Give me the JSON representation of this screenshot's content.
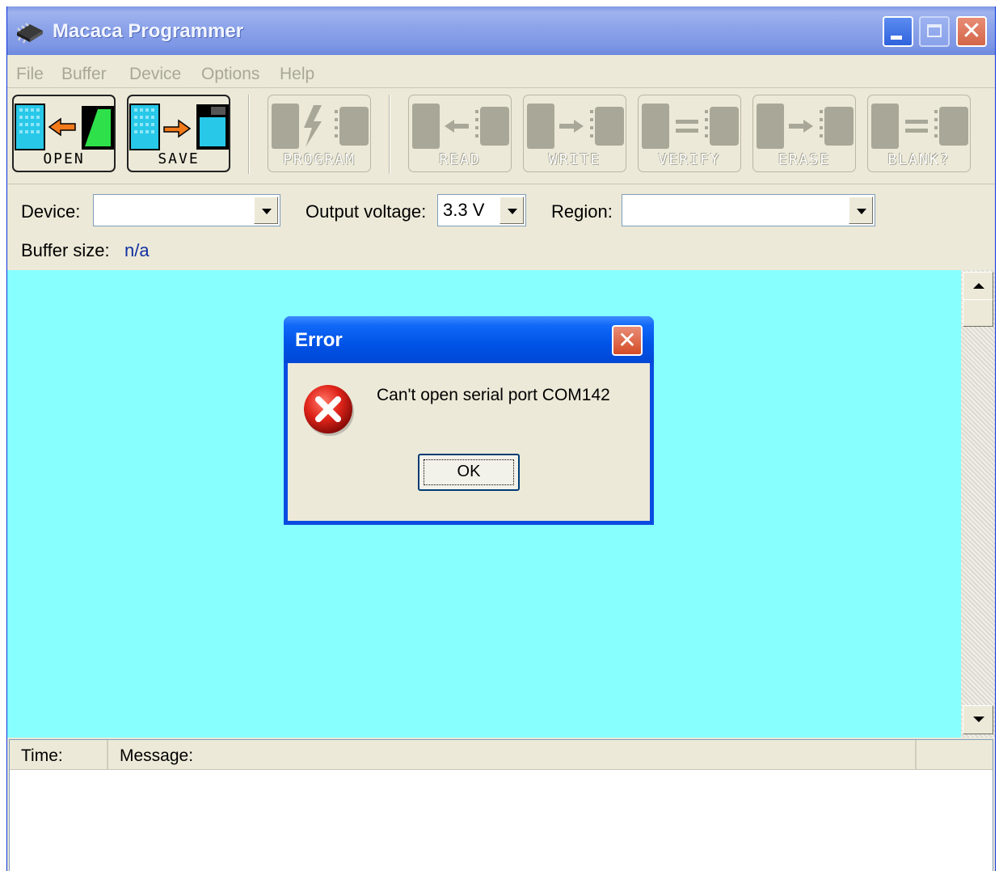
{
  "window": {
    "title": "Macaca Programmer"
  },
  "menu": [
    "File",
    "Buffer",
    "Device",
    "Options",
    "Help"
  ],
  "toolbar": {
    "open": "OPEN",
    "save": "SAVE",
    "program": "PROGRAM",
    "read": "READ",
    "write": "WRITE",
    "verify": "VERIFY",
    "erase": "ERASE",
    "blank": "BLANK?"
  },
  "settings": {
    "device_label": "Device:",
    "device_value": "",
    "output_voltage_label": "Output voltage:",
    "output_voltage_value": "3.3 V",
    "region_label": "Region:",
    "region_value": "",
    "buffer_size_label": "Buffer size:",
    "buffer_size_value": "n/a"
  },
  "log": {
    "columns": [
      "Time:",
      "Message:"
    ]
  },
  "dialog": {
    "title": "Error",
    "message": "Can't open serial port COM142",
    "ok": "OK"
  },
  "colors": {
    "canvas": "#88ffff",
    "title_bar": "#7f99e4",
    "dialog_title": "#0053e6"
  }
}
